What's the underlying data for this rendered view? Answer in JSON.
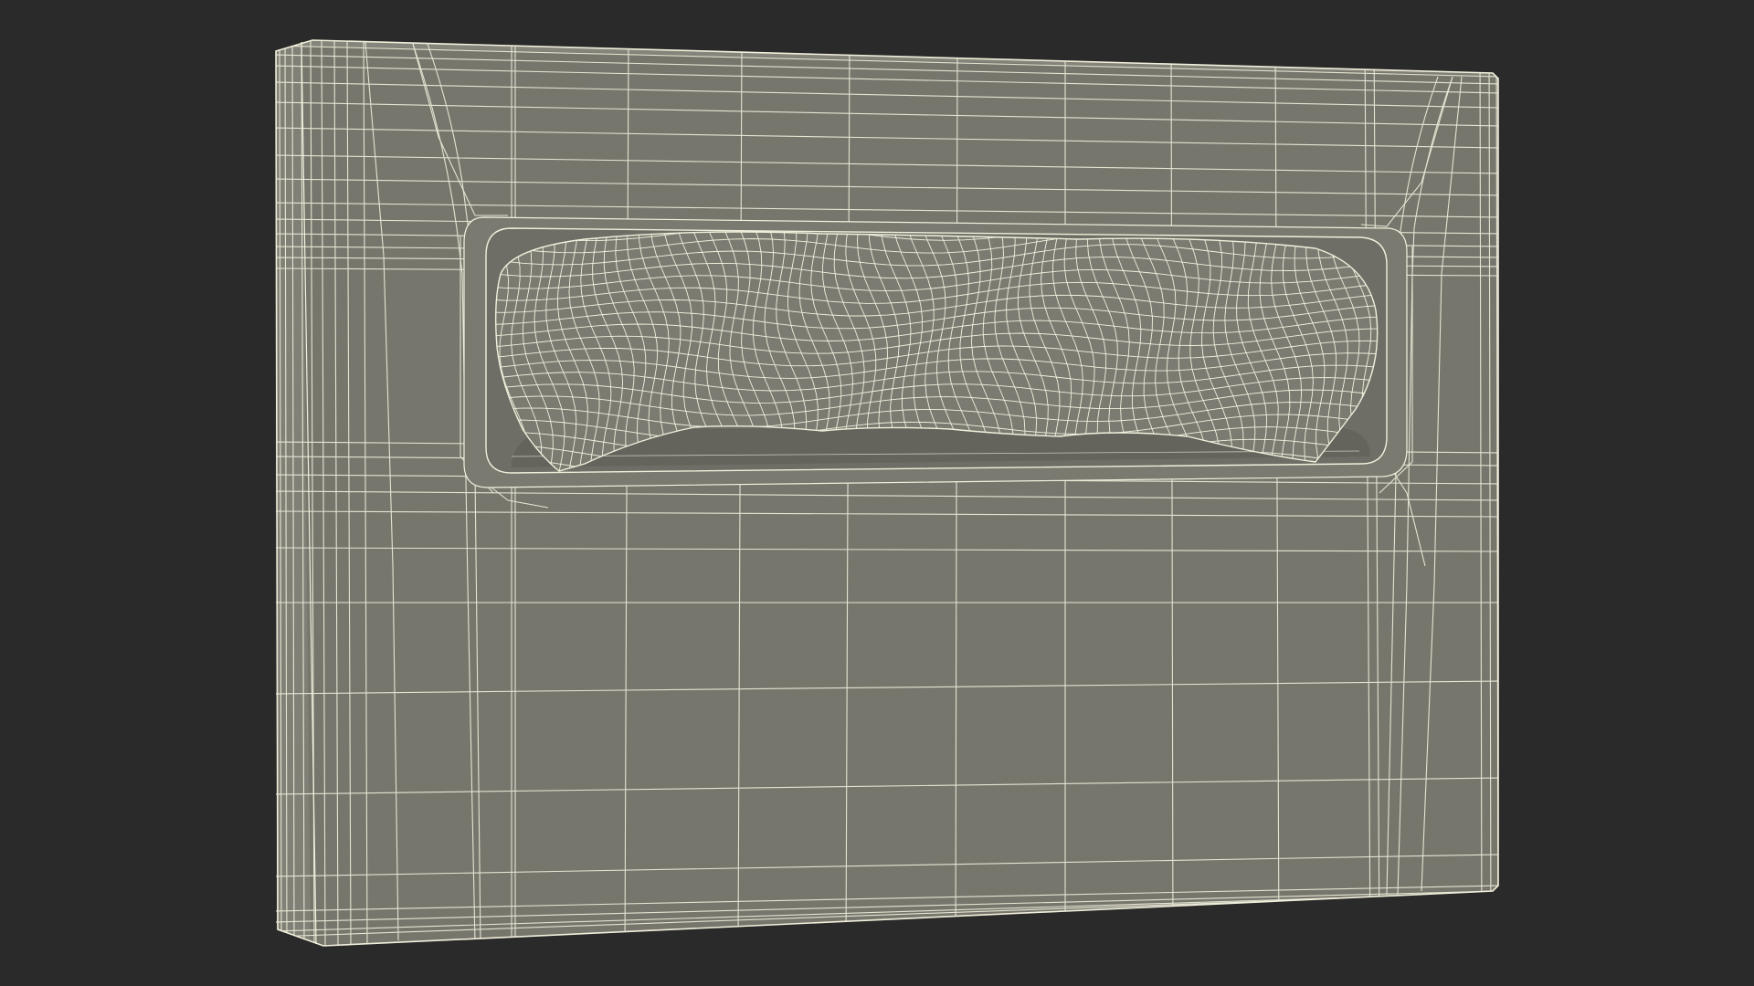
{
  "scene": {
    "background_color": "#2a2a2a",
    "surface_color": "#76766d",
    "recess_color": "#6e6e66",
    "shadow_color": "#5d5d56",
    "wire_color": "#f2f0dc",
    "object": "wireframe-box-with-slot-opening"
  }
}
